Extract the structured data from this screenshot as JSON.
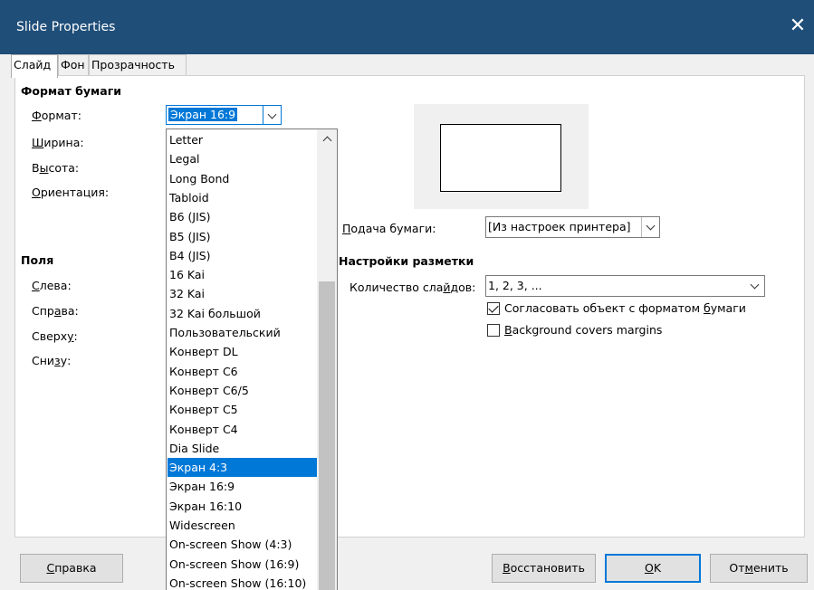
{
  "window": {
    "title": "Slide Properties",
    "close_glyph": "✕"
  },
  "tabs": [
    {
      "label": "Слайд",
      "active": true
    },
    {
      "label": "Фон",
      "active": false
    },
    {
      "label": "Прозрачность",
      "active": false
    }
  ],
  "paper_format": {
    "heading": "Формат бумаги",
    "format_label_u": "Ф",
    "format_label_rest": "ормат:",
    "format_value": "Экран 16:9",
    "width_label_u": "Ш",
    "width_label_rest": "ирина:",
    "height_label_pre": "В",
    "height_label_u": "ы",
    "height_label_rest": "сота:",
    "orientation_label_u": "О",
    "orientation_label_rest": "риентация:"
  },
  "margins": {
    "heading": "Поля",
    "left_label_u": "С",
    "left_label_rest": "лева:",
    "right_label_pre": "Спр",
    "right_label_u": "а",
    "right_label_rest": "ва:",
    "top_label_pre": "Сверх",
    "top_label_u": "у",
    "top_label_rest": ":",
    "bottom_label_pre": "Сни",
    "bottom_label_u": "з",
    "bottom_label_rest": "у:"
  },
  "paper_tray": {
    "label_u": "П",
    "label_rest": "одача бумаги:",
    "value": "[Из настроек принтера]"
  },
  "layout": {
    "heading": "Настройки разметки",
    "slide_count_label_pre": "Количество сла",
    "slide_count_label_u": "й",
    "slide_count_label_rest": "дов:",
    "slide_count_value": "1, 2, 3, ...",
    "fit_checkbox_pre": "Согласовать объект с форматом ",
    "fit_checkbox_u": "б",
    "fit_checkbox_rest": "умаги",
    "fit_checked": true,
    "bg_checkbox_u": "B",
    "bg_checkbox_rest": "ackground covers margins",
    "bg_checked": false
  },
  "format_options": [
    "Letter",
    "Legal",
    "Long Bond",
    "Tabloid",
    "B6 (JIS)",
    "B5 (JIS)",
    "B4 (JIS)",
    "16 Kai",
    "32 Kai",
    "32 Kai большой",
    "Пользовательский",
    "Конверт DL",
    "Конверт C6",
    "Конверт C6/5",
    "Конверт C5",
    "Конверт C4",
    "Dia Slide",
    "Экран 4:3",
    "Экран 16:9",
    "Экран 16:10",
    "Widescreen",
    "On-screen Show (4:3)",
    "On-screen Show (16:9)",
    "On-screen Show (16:10)"
  ],
  "format_highlighted": "Экран 4:3",
  "buttons": {
    "help_u": "С",
    "help_rest": "правка",
    "reset_u": "В",
    "reset_rest": "осстановить",
    "ok_u": "O",
    "ok_rest": "K",
    "cancel_pre": "От",
    "cancel_u": "м",
    "cancel_rest": "енить"
  },
  "colors": {
    "titlebar": "#1f4e79",
    "accent": "#0078d7"
  }
}
